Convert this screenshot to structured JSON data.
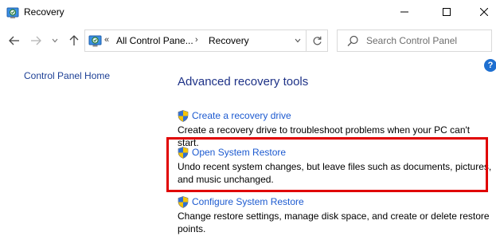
{
  "window": {
    "title": "Recovery"
  },
  "address": {
    "crumb_overflow": "«",
    "crumb_parent": "All Control Pane...",
    "crumb_separator": "›",
    "crumb_current": "Recovery"
  },
  "search": {
    "placeholder": "Search Control Panel"
  },
  "help": {
    "label": "?"
  },
  "sidebar": {
    "home_link": "Control Panel Home"
  },
  "main": {
    "title": "Advanced recovery tools",
    "tasks": [
      {
        "link": "Create a recovery drive",
        "description": "Create a recovery drive to troubleshoot problems when your PC can't start."
      },
      {
        "link": "Open System Restore",
        "description": "Undo recent system changes, but leave files such as documents, pictures, and music unchanged."
      },
      {
        "link": "Configure System Restore",
        "description": "Change restore settings, manage disk space, and create or delete restore points."
      }
    ]
  },
  "colors": {
    "link": "#1c5ad0",
    "title": "#1e3287",
    "highlight": "#e00000",
    "help": "#1e6fd0"
  },
  "icons": {
    "app": "recovery-control-panel-icon",
    "task": "uac-shield-icon",
    "search": "search-icon",
    "refresh": "refresh-icon"
  }
}
